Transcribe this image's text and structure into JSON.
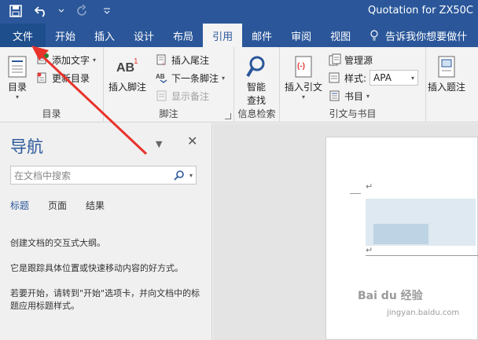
{
  "window": {
    "title": "Quotation for ZX50C"
  },
  "qat": {
    "save_icon": "save-icon",
    "undo_icon": "undo-icon",
    "redo_icon": "redo-icon",
    "customize_icon": "customize-qat-icon"
  },
  "tabs": [
    {
      "label": "文件"
    },
    {
      "label": "开始"
    },
    {
      "label": "插入"
    },
    {
      "label": "设计"
    },
    {
      "label": "布局"
    },
    {
      "label": "引用"
    },
    {
      "label": "邮件"
    },
    {
      "label": "审阅"
    },
    {
      "label": "视图"
    }
  ],
  "tellme": {
    "label": "告诉我你想要做什"
  },
  "ribbon": {
    "toc_group": {
      "label": "目录",
      "toc_button": "目录",
      "add_text": "添加文字",
      "update_toc": "更新目录"
    },
    "footnote_group": {
      "label": "脚注",
      "insert_footnote": "插入脚注",
      "insert_endnote": "插入尾注",
      "next_footnote": "下一条脚注",
      "show_notes": "显示备注"
    },
    "research_group": {
      "label": "信息检索",
      "smart_lookup": "智能",
      "smart_lookup_2": "查找"
    },
    "citation_group": {
      "label": "引文与书目",
      "insert_citation": "插入引文",
      "manage_sources": "管理源",
      "style_label": "样式:",
      "style_value": "APA",
      "bibliography": "书目"
    },
    "caption_group": {
      "insert_caption": "插入题注"
    }
  },
  "navpane": {
    "title": "导航",
    "search_placeholder": "在文档中搜索",
    "tabs": [
      "标题",
      "页面",
      "结果"
    ],
    "line1": "创建文档的交互式大纲。",
    "line2": "它是跟踪具体位置或快速移动内容的好方式。",
    "line3": "若要开始，请转到\"开始\"选项卡，并向文档中的标题应用标题样式。"
  },
  "doc": {
    "para_mark": "↵"
  },
  "watermark": {
    "text": "Bai du 经验",
    "sub": "jingyan.baidu.com"
  },
  "colors": {
    "accent": "#2b579a",
    "arrow": "#e8332b"
  }
}
